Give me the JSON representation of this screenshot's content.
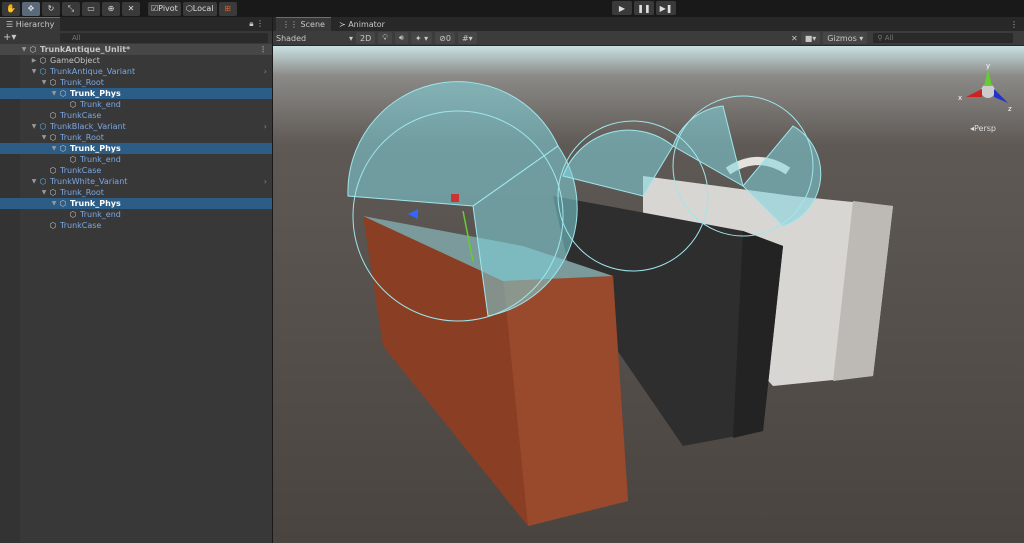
{
  "toolbar": {
    "tools": [
      "hand",
      "move",
      "rotate",
      "scale",
      "rect",
      "transform",
      "custom"
    ],
    "pivot": "Pivot",
    "local": "Local",
    "play": "▶",
    "pause": "❚❚",
    "step": "▶❚"
  },
  "hierarchy": {
    "tab": "Hierarchy",
    "add": "+▾",
    "search_placeholder": "All",
    "rows": [
      {
        "label": "TrunkAntique_Unlit*",
        "depth": 0,
        "kind": "root"
      },
      {
        "label": "GameObject",
        "depth": 1,
        "kind": "go"
      },
      {
        "label": "TrunkAntique_Variant",
        "depth": 1,
        "kind": "prefab"
      },
      {
        "label": "Trunk_Root",
        "depth": 2,
        "kind": "child"
      },
      {
        "label": "Trunk_Phys",
        "depth": 3,
        "kind": "selected"
      },
      {
        "label": "Trunk_end",
        "depth": 4,
        "kind": "child"
      },
      {
        "label": "TrunkCase",
        "depth": 2,
        "kind": "child"
      },
      {
        "label": "TrunkBlack_Variant",
        "depth": 1,
        "kind": "prefab"
      },
      {
        "label": "Trunk_Root",
        "depth": 2,
        "kind": "child"
      },
      {
        "label": "Trunk_Phys",
        "depth": 3,
        "kind": "selected"
      },
      {
        "label": "Trunk_end",
        "depth": 4,
        "kind": "child"
      },
      {
        "label": "TrunkCase",
        "depth": 2,
        "kind": "child"
      },
      {
        "label": "TrunkWhite_Variant",
        "depth": 1,
        "kind": "prefab"
      },
      {
        "label": "Trunk_Root",
        "depth": 2,
        "kind": "child"
      },
      {
        "label": "Trunk_Phys",
        "depth": 3,
        "kind": "selected"
      },
      {
        "label": "Trunk_end",
        "depth": 4,
        "kind": "child"
      },
      {
        "label": "TrunkCase",
        "depth": 2,
        "kind": "child"
      }
    ]
  },
  "scene": {
    "tabs": [
      "Scene",
      "Animator"
    ],
    "shading": "Shaded",
    "mode2d": "2D",
    "hidden_count": "0",
    "gizmos": "Gizmos",
    "search_placeholder": "All",
    "projection": "Persp",
    "axes": {
      "x": "x",
      "y": "y",
      "z": "z"
    }
  }
}
